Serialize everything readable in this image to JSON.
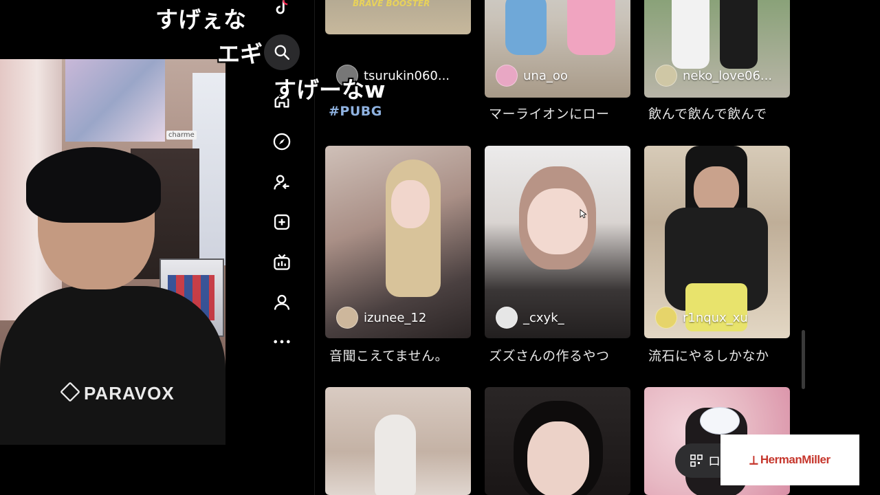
{
  "overlay_subtitles": {
    "line1": "すげぇな",
    "line2": "エギ",
    "line3": "すげーなw"
  },
  "webcam": {
    "shirt_logo": "PARAVOX",
    "room_sign": "charme"
  },
  "nav": {
    "icons": [
      "tiktok-logo-icon",
      "search-icon",
      "home-icon",
      "explore-compass-icon",
      "following-icon",
      "upload-plus-icon",
      "live-tv-icon",
      "profile-icon",
      "more-icon"
    ]
  },
  "feed": {
    "row1": [
      {
        "user": "tsurukin060...",
        "caption": "#PUBG",
        "banner": "BRAVE BOOSTER"
      },
      {
        "user": "una_oo",
        "caption": "マーライオンにロー"
      },
      {
        "user": "neko_love06...",
        "caption": "飲んで飲んで飲んで"
      }
    ],
    "row2": [
      {
        "user": "izunee_12",
        "caption": "音聞こえてません。"
      },
      {
        "user": "_cxyk_",
        "caption": "ズズさんの作るやつ"
      },
      {
        "user": "r1nqux_xu",
        "caption": "流石にやるしかなか"
      }
    ]
  },
  "login": {
    "label": "ログ"
  },
  "sponsor": {
    "brand": "HermanMiller"
  },
  "colors": {
    "background": "#000000",
    "hashtag": "#8fb2e0",
    "sponsor_red": "#c6362c"
  }
}
